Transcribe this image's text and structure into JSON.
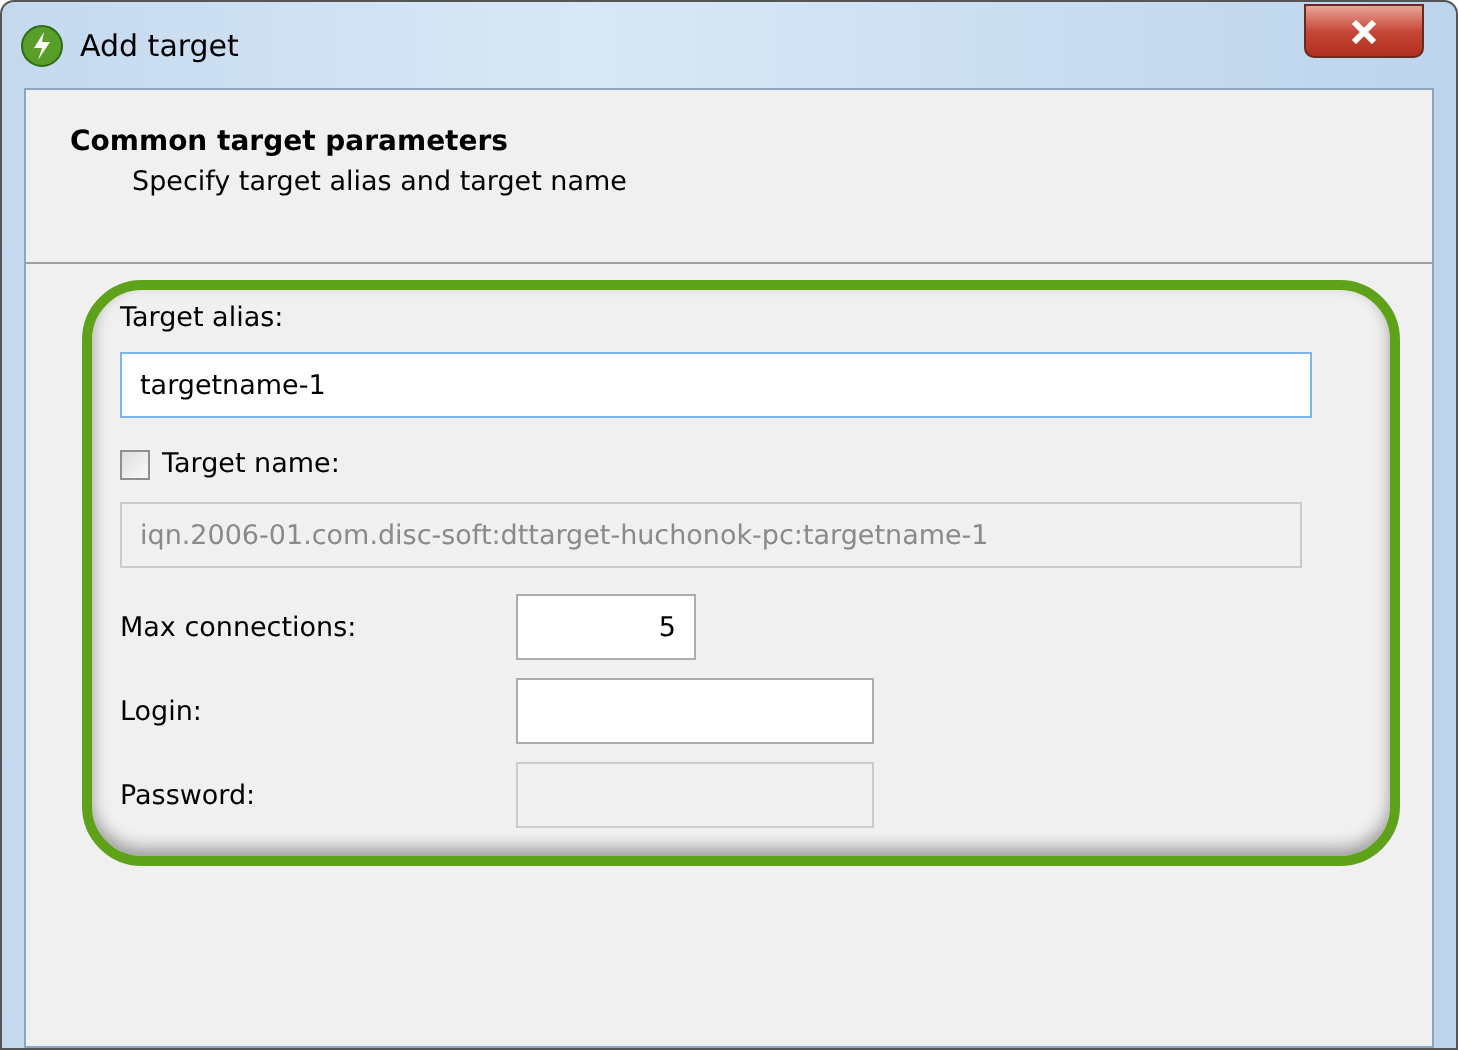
{
  "window": {
    "title": "Add target"
  },
  "header": {
    "title": "Common target parameters",
    "subtitle": "Specify target alias and target name"
  },
  "alias": {
    "label": "Target alias:",
    "value": "targetname-1",
    "disabled": false
  },
  "target_name": {
    "label": "Target name:",
    "checked": false,
    "value": "iqn.2006-01.com.disc-soft:dttarget-huchonok-pc:targetname-1",
    "disabled": true
  },
  "small_fields": [
    {
      "label": "Max connections:",
      "value": "5",
      "disabled": false,
      "kind": "number"
    },
    {
      "label": "Login:",
      "disabled": false,
      "kind": "text"
    },
    {
      "label": "Password:",
      "disabled": true,
      "kind": "text"
    }
  ]
}
